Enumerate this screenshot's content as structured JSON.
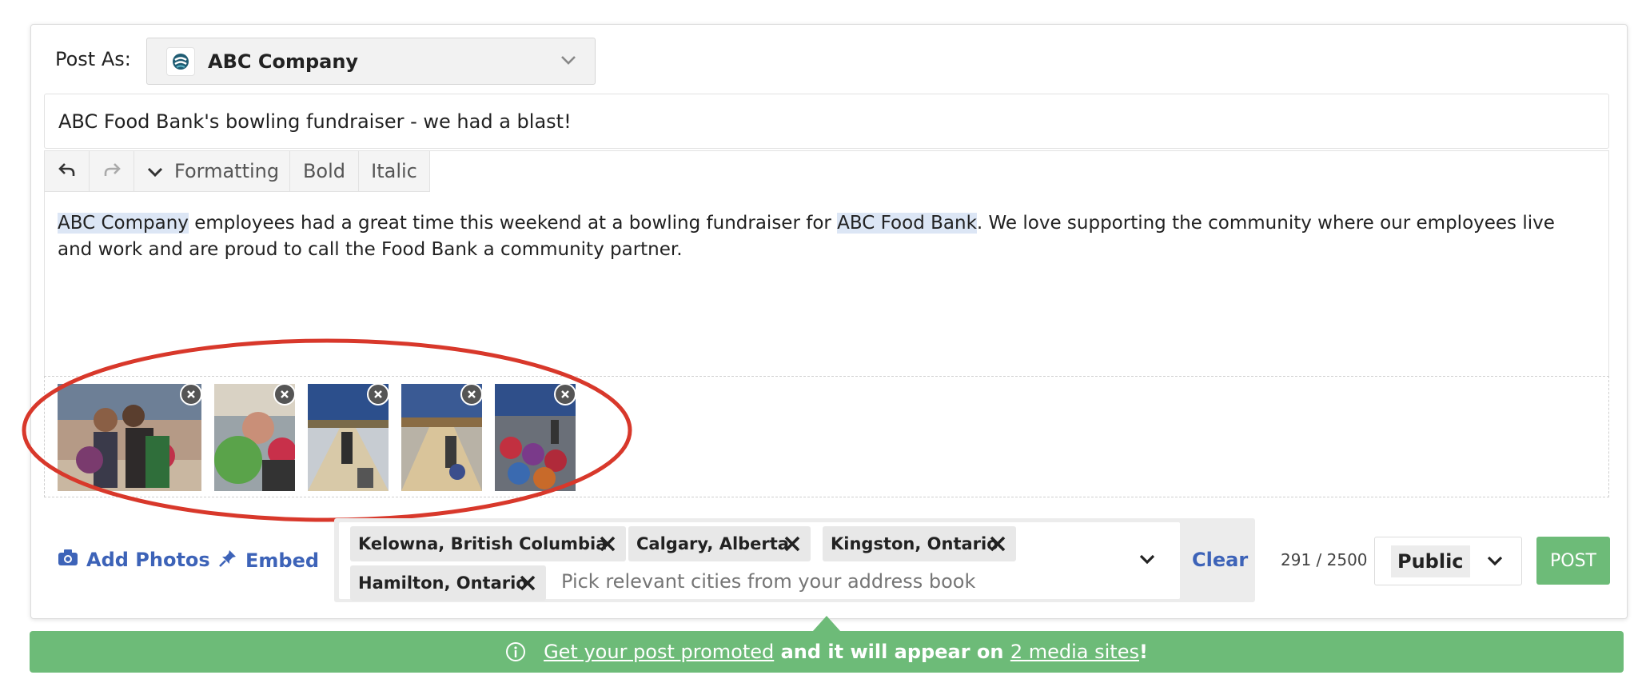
{
  "post_as": {
    "label": "Post As:",
    "account_name": "ABC Company"
  },
  "title": {
    "value": "ABC Food Bank's bowling fundraiser - we had a blast!"
  },
  "toolbar": {
    "undo_icon": "undo-icon",
    "redo_icon": "redo-icon",
    "formatting_label": "Formatting",
    "bold_label": "Bold",
    "italic_label": "Italic"
  },
  "body": {
    "mention1": "ABC Company",
    "text1": " employees had a great time this weekend at a bowling fundraiser for ",
    "mention2": "ABC Food Bank",
    "text2": ". We love supporting the community where our employees live and work and are proud to call the Food Bank a community partner."
  },
  "photos": [
    {
      "name": "photo-1",
      "remove_icon": "close-icon"
    },
    {
      "name": "photo-2",
      "remove_icon": "close-icon"
    },
    {
      "name": "photo-3",
      "remove_icon": "close-icon"
    },
    {
      "name": "photo-4",
      "remove_icon": "close-icon"
    },
    {
      "name": "photo-5",
      "remove_icon": "close-icon"
    }
  ],
  "actions": {
    "add_photos_label": "Add Photos",
    "add_photos_icon": "camera-icon",
    "embed_label": "Embed",
    "embed_icon": "pin-icon"
  },
  "cities": {
    "selected": [
      "Kelowna, British Columbia",
      "Calgary, Alberta",
      "Kingston, Ontario",
      "Hamilton, Ontario"
    ],
    "placeholder": "Pick relevant cities from your address book",
    "clear_label": "Clear"
  },
  "char_count": {
    "text": "291 / 2500"
  },
  "visibility": {
    "value": "Public"
  },
  "post_button": {
    "label": "POST"
  },
  "promo": {
    "link1": "Get your post promoted",
    "middle": " and it will appear on ",
    "link2": "2 media sites",
    "end": "!"
  },
  "colors": {
    "accent_green": "#6dbb78",
    "link_blue": "#3d63b8",
    "annotation_red": "#d8382b"
  }
}
